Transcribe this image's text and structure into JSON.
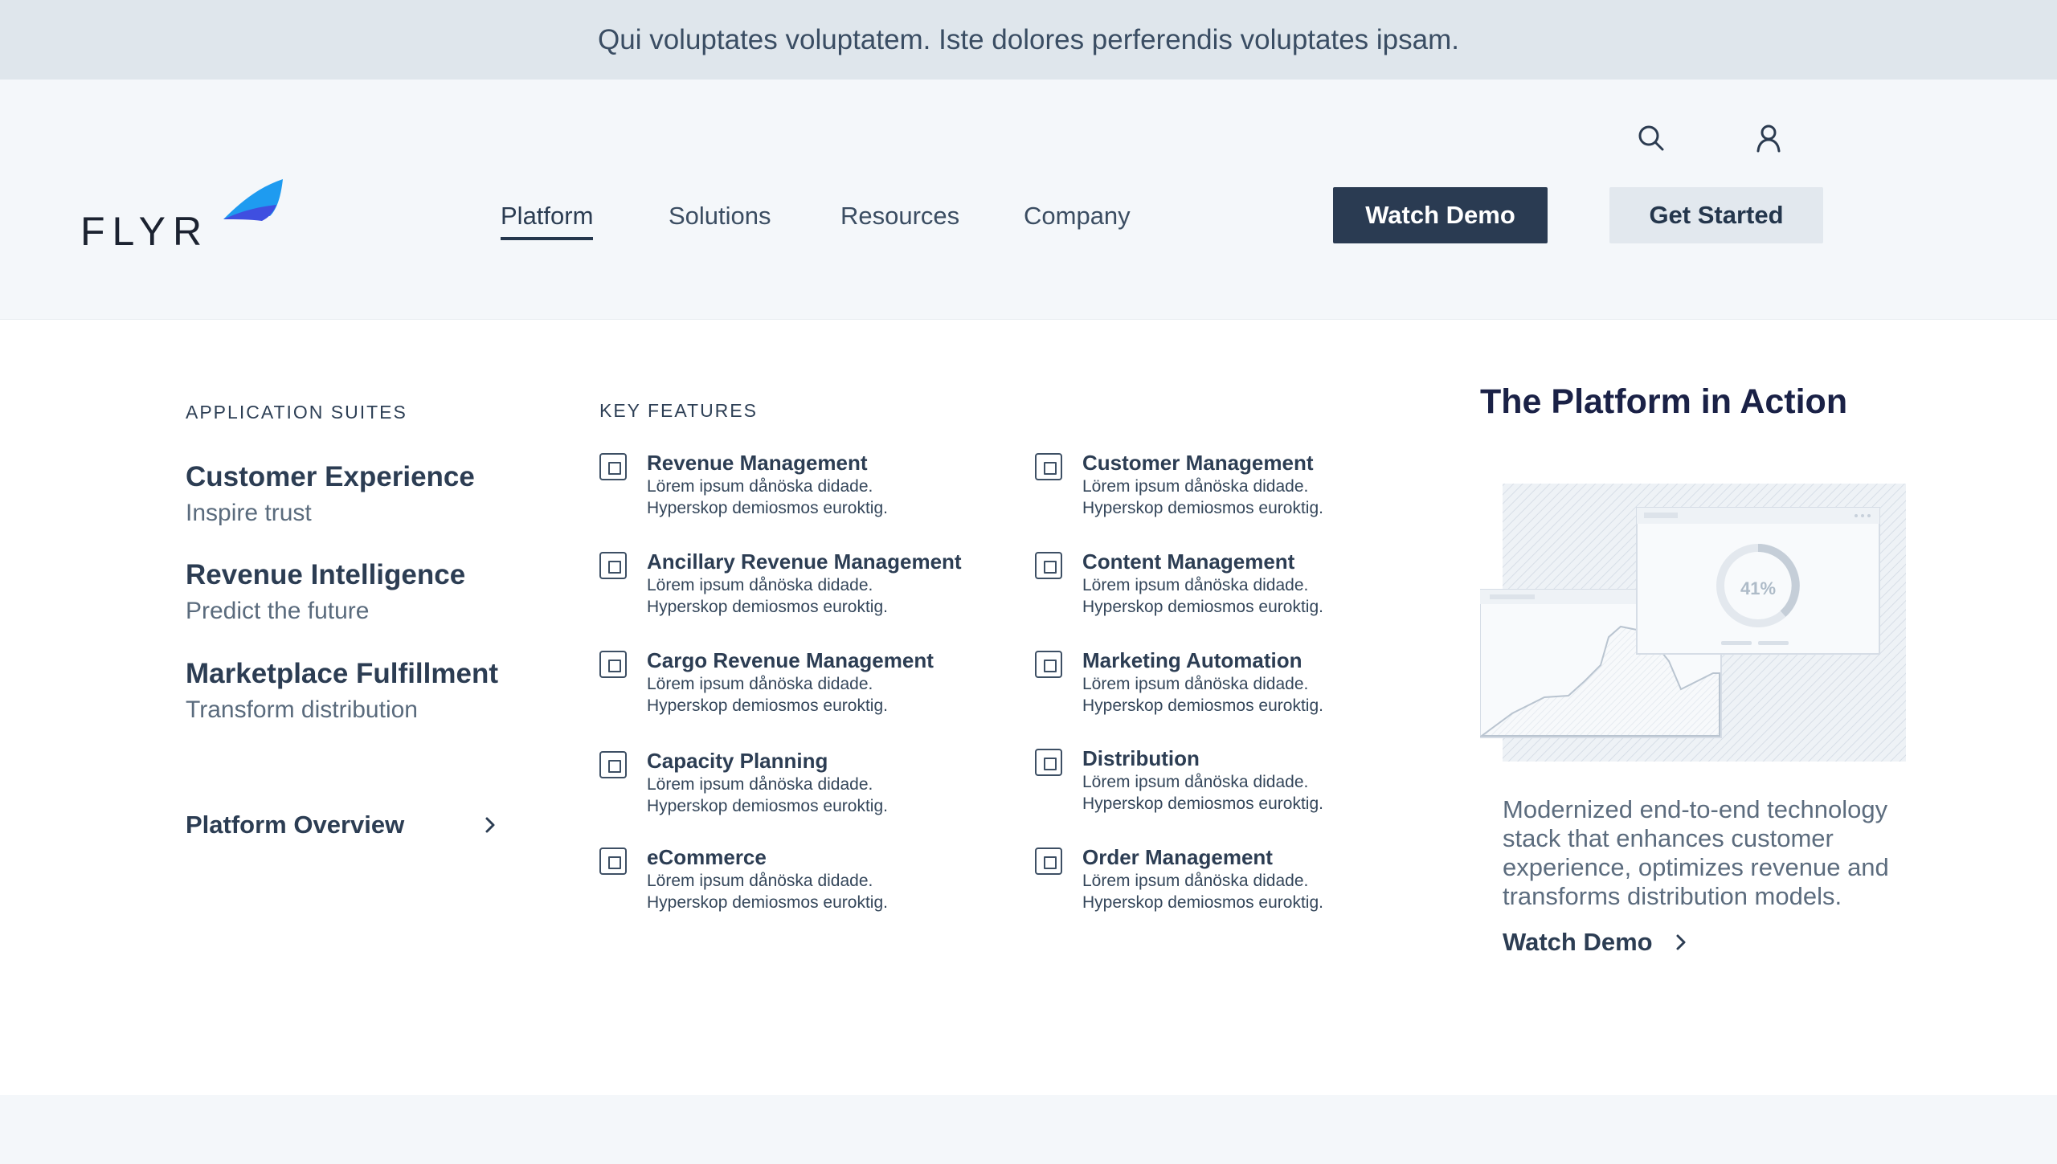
{
  "announcement": "Qui voluptates voluptatem. Iste dolores perferendis voluptates ipsam.",
  "brand": {
    "name": "FLYR",
    "accent": "#3f6bff"
  },
  "nav": [
    {
      "label": "Platform",
      "active": true
    },
    {
      "label": "Solutions",
      "active": false
    },
    {
      "label": "Resources",
      "active": false
    },
    {
      "label": "Company",
      "active": false
    }
  ],
  "header_icons": [
    "search-icon",
    "user-icon"
  ],
  "buttons": {
    "watch_demo": "Watch Demo",
    "get_started": "Get Started"
  },
  "menu": {
    "suites_label": "APPLICATION SUITES",
    "suites": [
      {
        "title": "Customer Experience",
        "subtitle": "Inspire trust"
      },
      {
        "title": "Revenue Intelligence",
        "subtitle": "Predict the future"
      },
      {
        "title": "Marketplace Fulfillment",
        "subtitle": "Transform distribution"
      }
    ],
    "overview_link": "Platform Overview",
    "features_label": "KEY FEATURES",
    "features": [
      {
        "title": "Revenue Management",
        "line1": "Lörem ipsum dånöska didade.",
        "line2": "Hyperskop demiosmos euroktig."
      },
      {
        "title": "Customer Management",
        "line1": "Lörem ipsum dånöska didade.",
        "line2": "Hyperskop demiosmos euroktig."
      },
      {
        "title": "Ancillary Revenue Management",
        "line1": "Lörem ipsum dånöska didade.",
        "line2": "Hyperskop demiosmos euroktig."
      },
      {
        "title": "Content Management",
        "line1": "Lörem ipsum dånöska didade.",
        "line2": "Hyperskop demiosmos euroktig."
      },
      {
        "title": "Cargo Revenue Management",
        "line1": "Lörem ipsum dånöska didade.",
        "line2": "Hyperskop demiosmos euroktig."
      },
      {
        "title": "Marketing Automation",
        "line1": "Lörem ipsum dånöska didade.",
        "line2": "Hyperskop demiosmos euroktig."
      },
      {
        "title": "Capacity Planning",
        "line1": "Lörem ipsum dånöska didade.",
        "line2": "Hyperskop demiosmos euroktig."
      },
      {
        "title": "Distribution",
        "line1": "Lörem ipsum dånöska didade.",
        "line2": "Hyperskop demiosmos euroktig."
      },
      {
        "title": "eCommerce",
        "line1": "Lörem ipsum dånöska didade.",
        "line2": "Hyperskop demiosmos euroktig."
      },
      {
        "title": "Order Management",
        "line1": "Lörem ipsum dånöska didade.",
        "line2": "Hyperskop demiosmos euroktig."
      }
    ],
    "action_title": "The Platform in  Action",
    "illustration_percent": "41%",
    "action_description": "Modernized end-to-end technology stack that enhances customer experience, optimizes revenue and transforms distribution models.",
    "action_link": "Watch Demo"
  }
}
